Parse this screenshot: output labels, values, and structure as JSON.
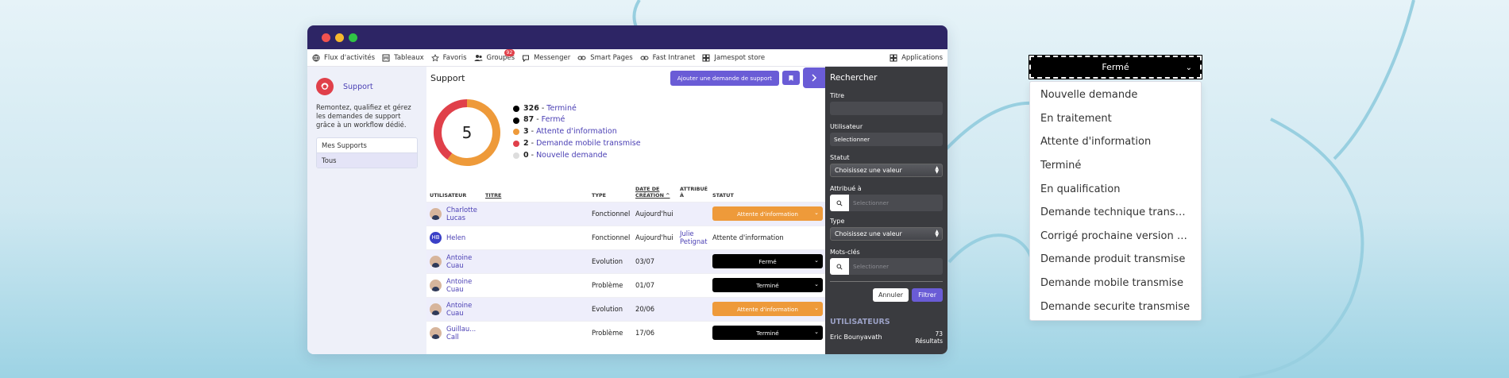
{
  "colors": {
    "accent": "#6a5cd6",
    "titlebar": "#2d2565",
    "link": "#4a3fb4",
    "orange": "#ee9a3a",
    "red": "#e0404a",
    "black": "#000000",
    "grey": "#dddddd"
  },
  "topnav": {
    "items": [
      {
        "label": "Flux d'activités",
        "icon": "globe-icon"
      },
      {
        "label": "Tableaux",
        "icon": "board-icon"
      },
      {
        "label": "Favoris",
        "icon": "star-icon"
      },
      {
        "label": "Groupes",
        "icon": "people-icon",
        "badge": "92"
      },
      {
        "label": "Messenger",
        "icon": "chat-icon"
      },
      {
        "label": "Smart Pages",
        "icon": "link-icon"
      },
      {
        "label": "Fast Intranet",
        "icon": "link-icon"
      },
      {
        "label": "Jamespot store",
        "icon": "store-icon"
      }
    ],
    "applications": "Applications"
  },
  "sidebar": {
    "title": "Support",
    "description": "Remontez, qualifiez et gérez les demandes de support grâce à un workflow dédié.",
    "tabs": [
      "Mes Supports",
      "Tous"
    ]
  },
  "main": {
    "title": "Support",
    "add_button": "Ajouter une demande de support",
    "donut_total": "5",
    "donut_segments": [
      {
        "label": "Attente d'information",
        "value": 3
      },
      {
        "label": "Demande mobile transmise",
        "value": 2
      }
    ],
    "legend": [
      {
        "count": "326",
        "label": "Terminé",
        "color": "#000000"
      },
      {
        "count": "87",
        "label": "Fermé",
        "color": "#000000"
      },
      {
        "count": "3",
        "label": "Attente d'information",
        "color": "#ee9a3a"
      },
      {
        "count": "2",
        "label": "Demande mobile transmise",
        "color": "#e0404a"
      },
      {
        "count": "0",
        "label": "Nouvelle demande",
        "color": "#dddddd"
      }
    ],
    "columns": {
      "user": "UTILISATEUR",
      "title": "TITRE",
      "type": "TYPE",
      "date_1": "DATE DE",
      "date_2": "CRÉATION ^",
      "assigned_1": "ATTRIBUÉ",
      "assigned_2": "À",
      "status": "STATUT"
    },
    "rows": [
      {
        "user_1": "Charlotte",
        "user_2": "Lucas",
        "avatar": "photo",
        "type": "Fonctionnel",
        "date": "Aujourd'hui",
        "assignee_1": "",
        "assignee_2": "",
        "status": "Attente d'information",
        "status_style": "orange"
      },
      {
        "user_1": "Helen",
        "user_2": "",
        "avatar": "HB",
        "type": "Fonctionnel",
        "date": "Aujourd'hui",
        "assignee_1": "Julie",
        "assignee_2": "Petignat",
        "status": "Attente d'information",
        "status_style": "text"
      },
      {
        "user_1": "Antoine",
        "user_2": "Cuau",
        "avatar": "photo",
        "type": "Evolution",
        "date": "03/07",
        "assignee_1": "",
        "assignee_2": "",
        "status": "Fermé",
        "status_style": "black"
      },
      {
        "user_1": "Antoine",
        "user_2": "Cuau",
        "avatar": "photo",
        "type": "Problème",
        "date": "01/07",
        "assignee_1": "",
        "assignee_2": "",
        "status": "Terminé",
        "status_style": "black"
      },
      {
        "user_1": "Antoine",
        "user_2": "Cuau",
        "avatar": "photo",
        "type": "Evolution",
        "date": "20/06",
        "assignee_1": "",
        "assignee_2": "",
        "status": "Attente d'information",
        "status_style": "orange"
      },
      {
        "user_1": "Guillau...",
        "user_2": "Call",
        "avatar": "photo",
        "type": "Problème",
        "date": "17/06",
        "assignee_1": "",
        "assignee_2": "",
        "status": "Terminé",
        "status_style": "black"
      }
    ]
  },
  "search": {
    "title": "Rechercher",
    "titre_label": "Titre",
    "user_label": "Utilisateur",
    "user_value": "Selectionner",
    "statut_label": "Statut",
    "statut_value": "Choisissez une valeur",
    "attribue_label": "Attribué à",
    "attribue_placeholder": "Selectionner",
    "type_label": "Type",
    "type_value": "Choisissez une valeur",
    "keywords_label": "Mots-clés",
    "keywords_placeholder": "Selectionner",
    "cancel": "Annuler",
    "filter": "Filtrer",
    "users_section": "UTILISATEURS",
    "user_name": "Eric Bounyavath",
    "user_count": "73",
    "user_count_label": "Résultats"
  },
  "dropdown": {
    "selected": "Fermé",
    "options": [
      "Nouvelle demande",
      "En traitement",
      "Attente d'information",
      "Terminé",
      "En qualification",
      "Demande technique transmi...",
      "Corrigé prochaine version m...",
      "Demande produit transmise",
      "Demande mobile transmise",
      "Demande securite transmise"
    ]
  }
}
